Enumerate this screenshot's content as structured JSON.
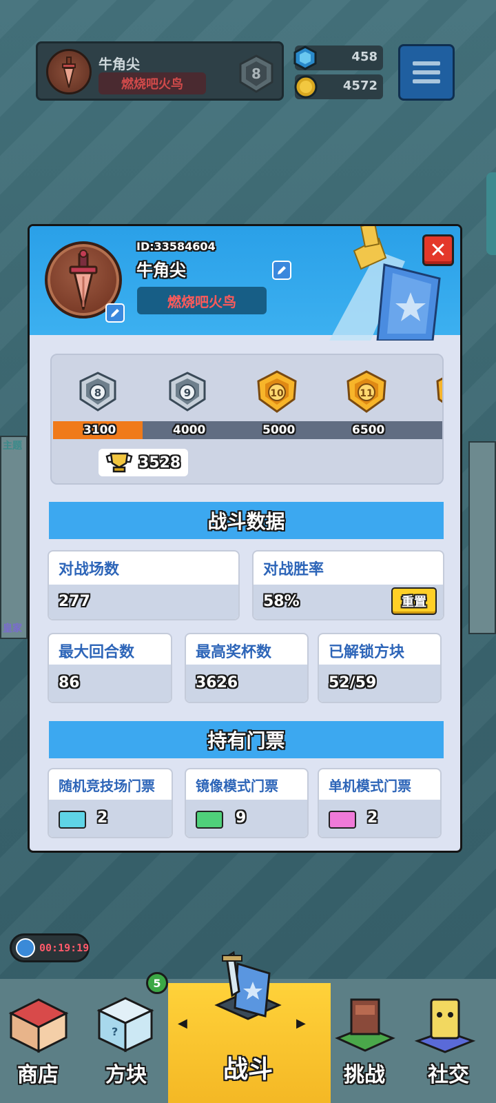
{
  "topbar": {
    "player_name": "牛角尖",
    "clan_name": "燃烧吧火鸟",
    "rank_level": "8",
    "gems": "458",
    "coins": "4572"
  },
  "profile": {
    "id_text": "ID:33584604",
    "name": "牛角尖",
    "clan": "燃烧吧火鸟",
    "close_label": "✕"
  },
  "trophy_road": {
    "ranks": [
      {
        "level": "8",
        "threshold": "3100",
        "tier": "silver"
      },
      {
        "level": "9",
        "threshold": "4000",
        "tier": "silver"
      },
      {
        "level": "10",
        "threshold": "5000",
        "tier": "gold"
      },
      {
        "level": "11",
        "threshold": "6500",
        "tier": "gold"
      }
    ],
    "current_trophies": "3528",
    "progress_fraction": 0.23
  },
  "battle_stats": {
    "title": "战斗数据",
    "battles_label": "对战场数",
    "battles_value": "277",
    "winrate_label": "对战胜率",
    "winrate_value": "58%",
    "reset_label": "重置",
    "max_rounds_label": "最大回合数",
    "max_rounds_value": "86",
    "max_trophies_label": "最高奖杯数",
    "max_trophies_value": "3626",
    "unlocked_label": "已解锁方块",
    "unlocked_value": "52/59"
  },
  "tickets": {
    "title": "持有门票",
    "items": [
      {
        "label": "随机竞技场门票",
        "count": "2",
        "color": "#5fd4e6"
      },
      {
        "label": "镜像模式门票",
        "count": "9",
        "color": "#4fd07a"
      },
      {
        "label": "单机模式门票",
        "count": "2",
        "color": "#f07ad8"
      }
    ]
  },
  "timer": "00:19:19",
  "side": {
    "left_top": "主题",
    "left_bottom": "皇家"
  },
  "nav": {
    "shop": "商店",
    "blocks": "方块",
    "blocks_badge": "5",
    "battle": "战斗",
    "challenge": "挑战",
    "social": "社交"
  },
  "colors": {
    "accent": "#3ca8f0",
    "progress": "#f07a1a",
    "clan_red": "#ff5a5a",
    "reset_yellow": "#ffd027"
  }
}
